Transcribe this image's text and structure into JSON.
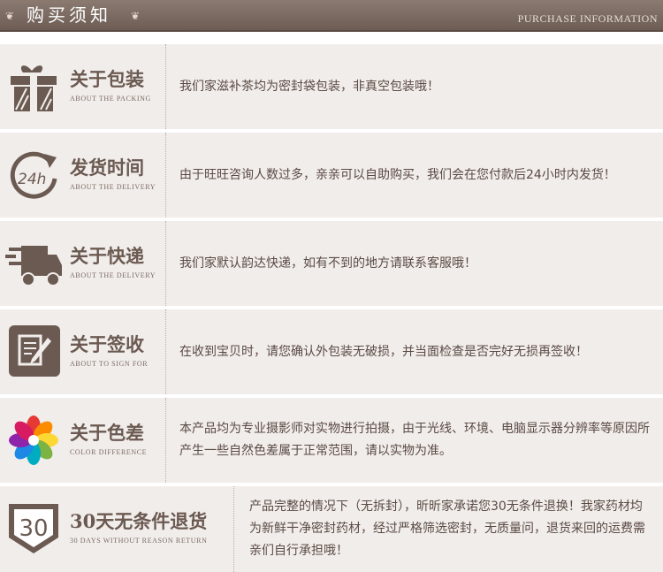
{
  "header": {
    "title": "购买须知",
    "subtitle": "PURCHASE INFORMATION"
  },
  "rows": [
    {
      "icon": "gift-box-icon",
      "title": "关于包装",
      "title_en": "ABOUT THE PACKING",
      "text": "我们家滋补茶均为密封袋包装，非真空包装哦！"
    },
    {
      "icon": "24h-clock-icon",
      "icon_text": "24h",
      "title": "发货时间",
      "title_en": "ABOUT THE DELIVERY",
      "text": "由于旺旺咨询人数过多，亲亲可以自助购买，我们会在您付款后24小时内发货！"
    },
    {
      "icon": "delivery-truck-icon",
      "title": "关于快递",
      "title_en": "ABOUT THE DELIVERY",
      "text": "我们家默认韵达快递，如有不到的地方请联系客服哦！"
    },
    {
      "icon": "sign-document-icon",
      "title": "关于签收",
      "title_en": "ABOUT TO SIGN FOR",
      "text": "在收到宝贝时，请您确认外包装无破损，并当面检查是否完好无损再签收！"
    },
    {
      "icon": "color-wheel-icon",
      "title": "关于色差",
      "title_en": "COLOR DIFFERENCE",
      "text": "本产品均为专业摄影师对实物进行拍摄，由于光线、环境、电脑显示器分辨率等原因所产生一些自然色差属于正常范围，请以实物为准。"
    },
    {
      "icon": "30-days-shield-icon",
      "icon_text": "30",
      "title": "30天无条件退货",
      "title_en": "30 DAYS WITHOUT REASON RETURN",
      "text": "产品完整的情况下（无拆封），昕昕家承诺您30无条件退换！我家药材均为新鲜干净密封药材，经过严格筛选密封，无质量问，退货来回的运费需亲们自行承担哦！"
    }
  ],
  "colors": {
    "header_bg": "#7a6a62",
    "row_bg": "#f1edeb",
    "text": "#5a4a44",
    "icon": "#6b5a52"
  }
}
